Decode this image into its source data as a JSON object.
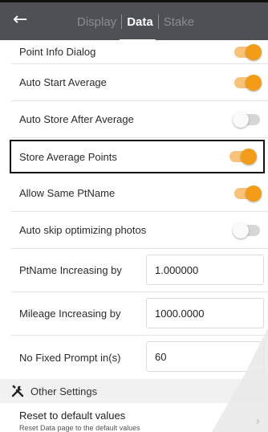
{
  "header": {
    "back_icon": "arrow-left-icon",
    "tabs": [
      {
        "label": "Display",
        "active": false
      },
      {
        "label": "Data",
        "active": true
      },
      {
        "label": "Stake",
        "active": false
      }
    ]
  },
  "settings": [
    {
      "label": "Point Info Dialog",
      "type": "toggle",
      "on": true
    },
    {
      "label": "Auto Start Average",
      "type": "toggle",
      "on": true
    },
    {
      "label": "Auto Store After Average",
      "type": "toggle",
      "on": false
    },
    {
      "label": "Store Average Points",
      "type": "toggle",
      "on": true,
      "highlighted": true
    },
    {
      "label": "Allow Same PtName",
      "type": "toggle",
      "on": true
    },
    {
      "label": "Auto skip optimizing photos",
      "type": "toggle",
      "on": false
    }
  ],
  "inputs": [
    {
      "label": "PtName Increasing by",
      "value": "1.000000"
    },
    {
      "label": "Mileage Increasing by",
      "value": "1000.0000"
    },
    {
      "label": "No Fixed Prompt in(s)",
      "value": "60"
    }
  ],
  "other_settings": {
    "icon": "tools-icon",
    "title": "Other Settings"
  },
  "reset": {
    "title": "Reset to default values",
    "subtitle": "Reset Data page to the default values",
    "icon": "chevron-right-icon"
  },
  "colors": {
    "header_bg": "#4f5056",
    "toggle_on": "#f39c1a",
    "toggle_on_track": "#f7c37a"
  }
}
